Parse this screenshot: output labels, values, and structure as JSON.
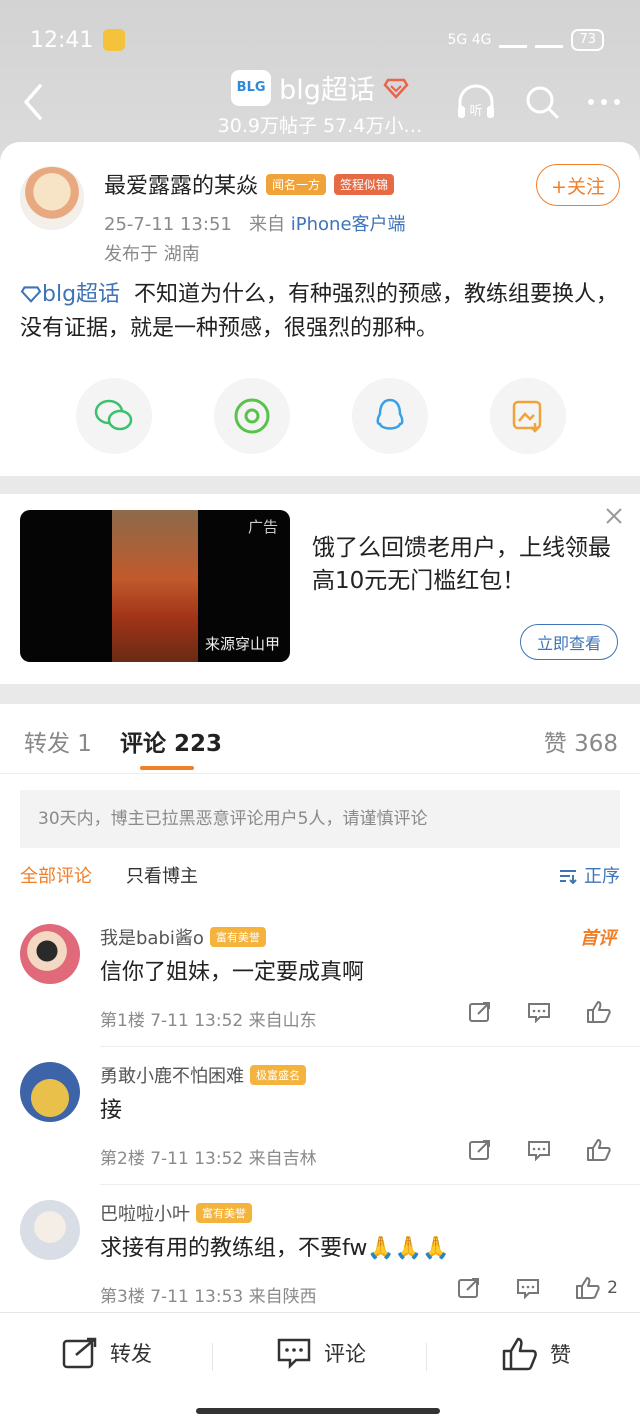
{
  "status": {
    "time": "12:41",
    "battery": "73",
    "network": "5G 4G"
  },
  "header": {
    "logo_text": "BLG",
    "title": "blg超话",
    "subtitle": "30.9万帖子 57.4万小…"
  },
  "post": {
    "author": "最爱露露的某焱",
    "badges": [
      "闻名一方",
      "签程似锦"
    ],
    "follow_label": "+关注",
    "time": "25-7-11 13:51",
    "from_prefix": "来自",
    "source": "iPhone客户端",
    "location": "发布于 湖南",
    "topic": "blg超话",
    "content": "不知道为什么，有种强烈的预感，教练组要换人，没有证据，就是一种预感，很强烈的那种。",
    "share": [
      "wechat-icon",
      "moments-icon",
      "qq-icon",
      "save-image-icon"
    ]
  },
  "ad": {
    "label": "广告",
    "source": "来源穿山甲",
    "text": "饿了么回馈老用户，上线领最高10元无门槛红包！",
    "button": "立即查看"
  },
  "tabs": {
    "repost": "转发 1",
    "comment": "评论 223",
    "like": "赞 368"
  },
  "notice": "30天内，博主已拉黑恶意评论用户5人，请谨慎评论",
  "filters": {
    "all": "全部评论",
    "owner": "只看博主",
    "sort": "正序"
  },
  "comments": [
    {
      "name": "我是babi酱o",
      "level": "富有美誉",
      "text": "信你了姐妹，一定要成真啊",
      "meta": "第1楼 7-11 13:52 来自山东",
      "tag": "首评",
      "likes": ""
    },
    {
      "name": "勇敢小鹿不怕困难",
      "level": "极富盛名",
      "text": "接",
      "meta": "第2楼 7-11 13:52 来自吉林",
      "tag": "",
      "likes": ""
    },
    {
      "name": "巴啦啦小叶",
      "level": "富有美誉",
      "text": "求接有用的教练组，不要fw🙏🙏🙏",
      "meta": "第3楼 7-11 13:53 来自陕西",
      "tag": "",
      "likes": "2"
    }
  ],
  "bottombar": {
    "repost": "转发",
    "comment": "评论",
    "like": "赞"
  }
}
